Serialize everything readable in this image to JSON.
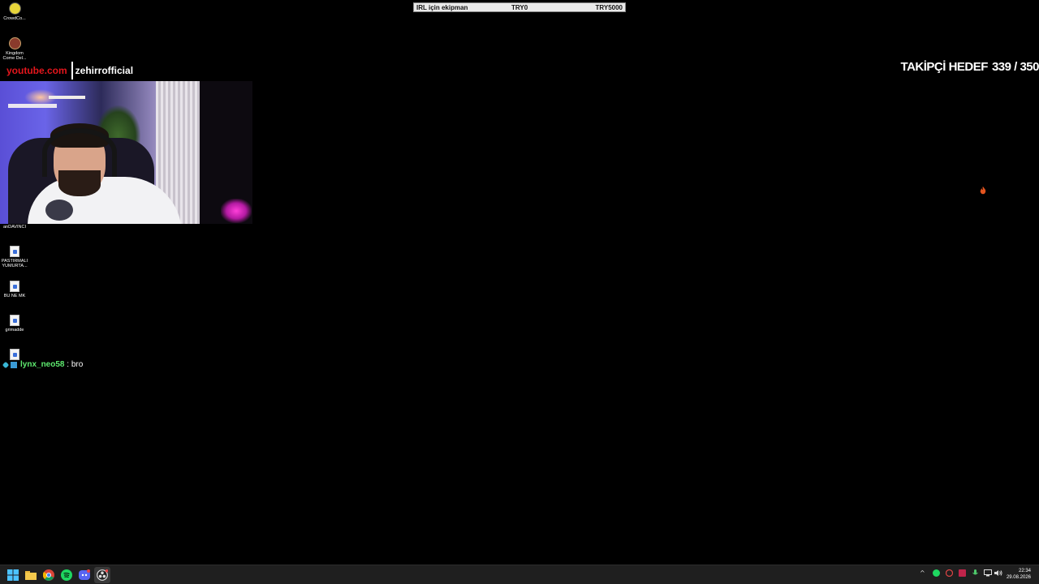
{
  "goal_bar": {
    "label": "IRL için ekipman",
    "current": "TRY0",
    "target": "TRY5000"
  },
  "follower_goal": {
    "label": "TAKİPÇİ HEDEF",
    "value": "339 / 350"
  },
  "social": {
    "site": "youtube.com",
    "handle": "zehirrofficial"
  },
  "desktop_icons": [
    {
      "label": "CrowdCo...",
      "icon": "crowd-app-icon"
    },
    {
      "label": "Kingdom Come Del...",
      "icon": "game-icon"
    },
    {
      "label": "anDAVINCI",
      "icon": "document-icon"
    },
    {
      "label": "PASTIRMALI YUMURTA...",
      "icon": "document-icon"
    },
    {
      "label": "BU NE MK",
      "icon": "document-icon"
    },
    {
      "label": "grimadde",
      "icon": "document-icon"
    },
    {
      "label": "",
      "icon": "document-icon"
    }
  ],
  "chat": {
    "username": "lynx_neo58",
    "separator": " : ",
    "message": "bro"
  },
  "taskbar": {
    "apps": [
      "start-icon",
      "file-explorer-icon",
      "chrome-icon",
      "spotify-icon",
      "discord-icon",
      "obs-icon"
    ],
    "tray": [
      "chevron-up-icon",
      "spotify-tray-icon",
      "antivirus-icon",
      "app-tray-icon",
      "mic-icon",
      "network-icon",
      "volume-icon"
    ],
    "time": "22:34",
    "date": "29.08.2026"
  },
  "colors": {
    "youtube_red": "#e4161c",
    "chat_username": "#5eea6f",
    "taskbar": "#1f1f1f",
    "background": "#000000"
  }
}
